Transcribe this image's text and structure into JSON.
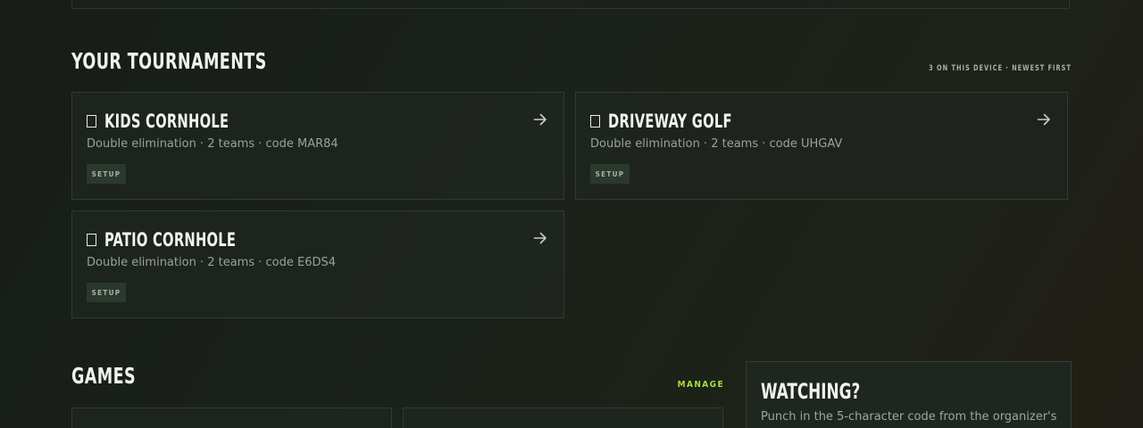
{
  "tournaments": {
    "title": "YOUR TOURNAMENTS",
    "meta": "3 ON THIS DEVICE · NEWEST FIRST",
    "items": [
      {
        "name": "KIDS CORNHOLE",
        "description": "Double elimination · 2 teams · code MAR84",
        "status": "SETUP"
      },
      {
        "name": "DRIVEWAY GOLF",
        "description": "Double elimination · 2 teams · code UHGAV",
        "status": "SETUP"
      },
      {
        "name": "PATIO CORNHOLE",
        "description": "Double elimination · 2 teams · code E6DS4",
        "status": "SETUP"
      }
    ]
  },
  "games": {
    "title": "GAMES",
    "manage_label": "MANAGE"
  },
  "watching": {
    "title": "WATCHING?",
    "description": "Punch in the 5-character code from the organizer's"
  },
  "icons": {
    "card_checkbox": "checkbox-icon",
    "card_arrow": "arrow-right-icon"
  },
  "colors": {
    "accent": "#a7dc3c",
    "background": "#1a1f1a",
    "card_border": "#313b31"
  }
}
